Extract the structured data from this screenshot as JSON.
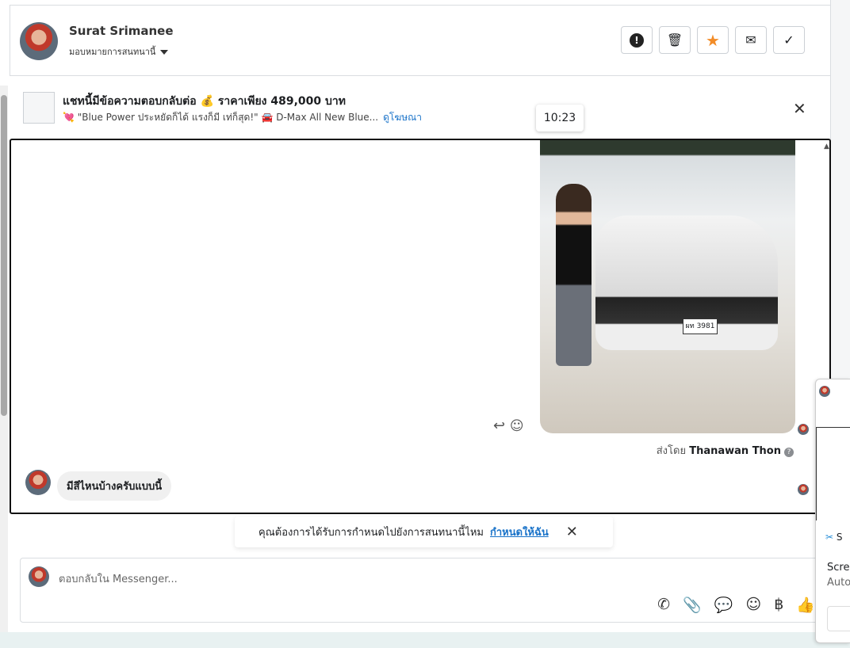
{
  "header": {
    "contact_name": "Surat Srimanee",
    "assign_label": "มอบหมายการสนทนานี้",
    "toolbar": [
      {
        "name": "report-spam-button",
        "icon": "!"
      },
      {
        "name": "delete-button",
        "icon": "🗑"
      },
      {
        "name": "star-button",
        "icon": "★"
      },
      {
        "name": "mark-unread-button",
        "icon": "✉"
      },
      {
        "name": "mark-done-button",
        "icon": "✓"
      }
    ]
  },
  "ad": {
    "title": "แชทนี้มีข้อความตอบกลับต่อ 💰 ราคาเพียง 489,000 บาท",
    "subtitle": "💘 \"Blue Power ประหยัดก็ได้ แรงก็มี เท่ก็สุด!\" 🚘 D-Max All New Blue...",
    "link": "ดูโฆษณา"
  },
  "chat": {
    "timestamp": "10:23",
    "sent_by_prefix": "ส่งโดย",
    "sent_by_name": "Thanawan Thon",
    "incoming_message": "มีสีไหนบ้างครับแบบนี้",
    "plate": "ผท 3981"
  },
  "notice": {
    "text": "คุณต้องการได้รับการกำหนดไปยังการสนทนานี้ไหม",
    "link": "กำหนดให้ฉัน"
  },
  "composer": {
    "placeholder": "ตอบกลับใน Messenger...",
    "icons": [
      "phone-add-icon",
      "paperclip-icon",
      "saved-reply-icon",
      "emoji-icon",
      "baht-icon",
      "thumbs-up-icon"
    ]
  },
  "popup": {
    "title": "S",
    "line1": "Scree",
    "line2": "Auto"
  },
  "colors": {
    "link": "#1a73c9",
    "star": "#f28c28"
  }
}
